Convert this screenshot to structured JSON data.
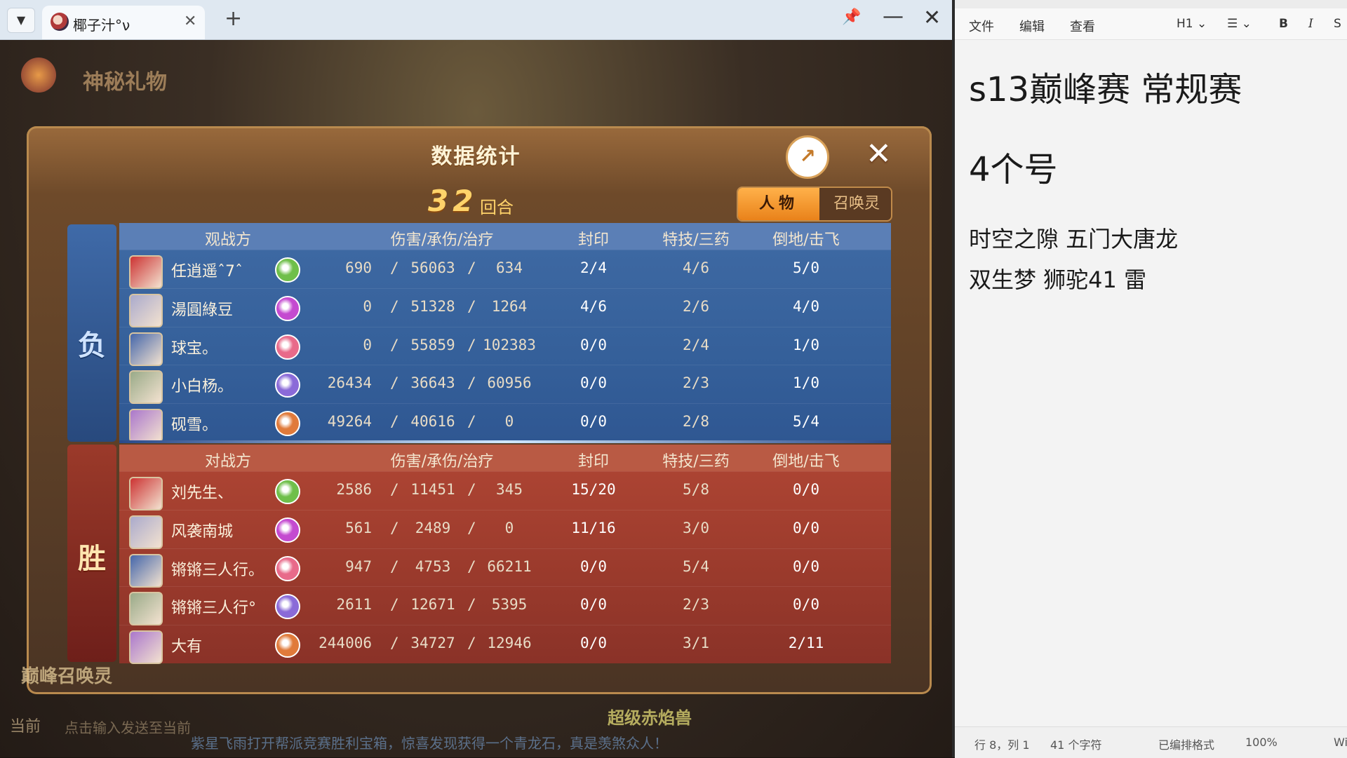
{
  "browser": {
    "tab_title": "椰子汁°ν",
    "close": "✕",
    "plus": "+",
    "pin": "📌",
    "min": "—",
    "x": "✕",
    "dropdown": "▼"
  },
  "game": {
    "mystery_gift": "神秘礼物",
    "modal": {
      "title": "数据统计",
      "share_icon": "↗",
      "close": "✕",
      "round_number": "32",
      "round_unit": "回合",
      "tab_character": "人物",
      "tab_summon": "召唤灵"
    },
    "lose_side_label": "负",
    "win_side_label": "胜",
    "columns": {
      "dmg": "伤害/承伤/治疗",
      "seal": "封印",
      "skill": "特技/三药",
      "ko": "倒地/击飞"
    },
    "spectator": {
      "header": "观战方",
      "rows": [
        {
          "name": "任逍遥ˆ7ˆ",
          "dmg": "690",
          "taken": "56063",
          "heal": "634",
          "seal": "2/4",
          "skill": "4/6",
          "ko": "5/0"
        },
        {
          "name": "湯圓綠豆",
          "dmg": "0",
          "taken": "51328",
          "heal": "1264",
          "seal": "4/6",
          "skill": "2/6",
          "ko": "4/0"
        },
        {
          "name": "球宝。",
          "dmg": "0",
          "taken": "55859",
          "heal": "102383",
          "seal": "0/0",
          "skill": "2/4",
          "ko": "1/0"
        },
        {
          "name": "小白杨。",
          "dmg": "26434",
          "taken": "36643",
          "heal": "60956",
          "seal": "0/0",
          "skill": "2/3",
          "ko": "1/0"
        },
        {
          "name": "砚雪。",
          "dmg": "49264",
          "taken": "40616",
          "heal": "0",
          "seal": "0/0",
          "skill": "2/8",
          "ko": "5/4"
        }
      ]
    },
    "opponent": {
      "header": "对战方",
      "rows": [
        {
          "name": "刘先生、",
          "dmg": "2586",
          "taken": "11451",
          "heal": "345",
          "seal": "15/20",
          "skill": "5/8",
          "ko": "0/0"
        },
        {
          "name": "风袭南城",
          "dmg": "561",
          "taken": "2489",
          "heal": "0",
          "seal": "11/16",
          "skill": "3/0",
          "ko": "0/0"
        },
        {
          "name": "锵锵三人行。",
          "dmg": "947",
          "taken": "4753",
          "heal": "66211",
          "seal": "0/0",
          "skill": "5/4",
          "ko": "0/0"
        },
        {
          "name": "锵锵三人行°",
          "dmg": "2611",
          "taken": "12671",
          "heal": "5395",
          "seal": "0/0",
          "skill": "2/3",
          "ko": "0/0"
        },
        {
          "name": "大有",
          "dmg": "244006",
          "taken": "34727",
          "heal": "12946",
          "seal": "0/0",
          "skill": "3/1",
          "ko": "2/11"
        }
      ]
    },
    "sect_colors": [
      "#6fbf4a",
      "#c44ad0",
      "#e86a8a",
      "#8a6ad8",
      "#e07a3a"
    ],
    "bottom_tag": "巅峰召唤灵",
    "chat_prompt": "当前",
    "chat_hint": "点击输入发送至当前",
    "banner": "超级赤焰兽",
    "marquee": "紫星飞雨打开帮派竞赛胜利宝箱，惊喜发现获得一个青龙石，真是羡煞众人！"
  },
  "editor": {
    "menu_file": "文件",
    "menu_edit": "编辑",
    "menu_view": "查看",
    "tool_h1": "H1 ⌄",
    "tool_list": "☰ ⌄",
    "tool_bold": "B",
    "tool_italic": "I",
    "tool_strike": "S",
    "heading1": "s13巅峰赛 常规赛",
    "heading2": "4个号",
    "line1": "时空之隙 五门大唐龙",
    "line2": "双生梦 狮驼41  雷",
    "status_pos": "行 8，列 1",
    "status_chars": "41 个字符",
    "status_format": "已编排格式",
    "status_zoom": "100%",
    "status_extra": "Wi"
  }
}
